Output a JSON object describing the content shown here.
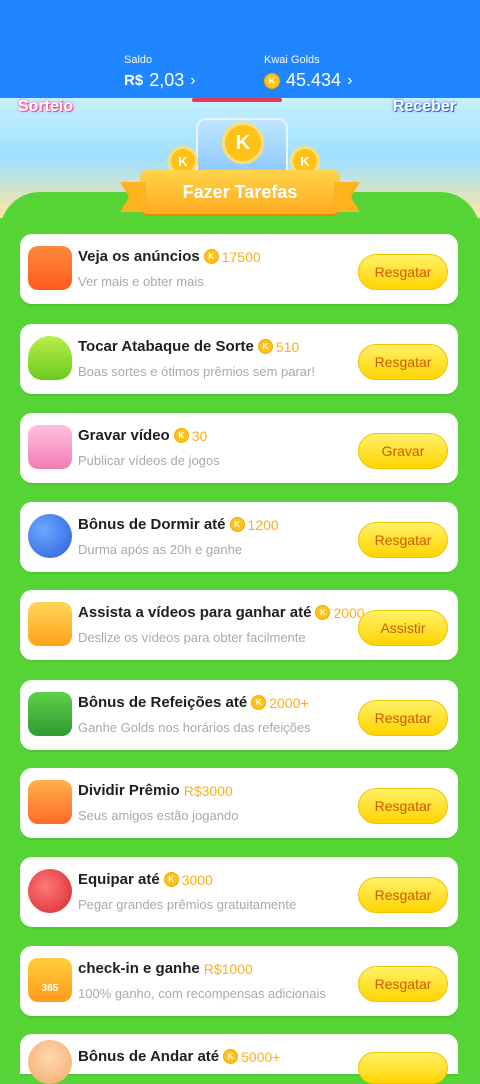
{
  "header": {
    "saldo_label": "Saldo",
    "saldo_currency": "R$",
    "saldo_value": "2,03",
    "golds_label": "Kwai Golds",
    "golds_value": "45.434"
  },
  "banner": {
    "left_text": "Sorteio",
    "right_text": "Receber",
    "section_title": "Fazer Tarefas",
    "coin_letter": "K"
  },
  "tasks": [
    {
      "title": "Veja os anúncios",
      "reward": "17500",
      "reward_type": "coin",
      "subtitle": "Ver mais e obter mais",
      "button": "Resgatar",
      "icon": "tv-icon"
    },
    {
      "title": "Tocar Atabaque de Sorte",
      "reward": "510",
      "reward_type": "coin",
      "subtitle": "Boas sortes e ótimos prêmios sem parar!",
      "button": "Resgatar",
      "icon": "drum-icon"
    },
    {
      "title": "Gravar vídeo",
      "reward": "30",
      "reward_type": "coin",
      "subtitle": "Publicar vídeos de jogos",
      "button": "Gravar",
      "icon": "camera-icon"
    },
    {
      "title": "Bônus de Dormir até",
      "reward": "1200",
      "reward_type": "coin",
      "subtitle": "Durma após as 20h e ganhe",
      "button": "Resgatar",
      "icon": "moon-icon"
    },
    {
      "title": "Assista a vídeos para ganhar até",
      "reward": "2000",
      "reward_type": "coin",
      "subtitle": "Deslize os vídeos para obter facilmente",
      "button": "Assistir",
      "icon": "video-camera-icon"
    },
    {
      "title": "Bônus de Refeições até",
      "reward": "2000+",
      "reward_type": "coin",
      "subtitle": "Ganhe Golds nos horários das refeições",
      "button": "Resgatar",
      "icon": "lunchbox-icon"
    },
    {
      "title": "Dividir Prêmio",
      "reward": "R$3000",
      "reward_type": "cash",
      "subtitle": "Seus amigos estão jogando",
      "button": "Resgatar",
      "icon": "gift-icon"
    },
    {
      "title": "Equipar até",
      "reward": "3000",
      "reward_type": "coin",
      "subtitle": "Pegar grandes prêmios gratuitamente",
      "button": "Resgatar",
      "icon": "boxing-glove-icon"
    },
    {
      "title": "check-in e ganhe",
      "reward": "R$1000",
      "reward_type": "cash",
      "subtitle": "100% ganho, com recompensas adicionais",
      "button": "Resgatar",
      "icon": "calendar-icon",
      "icon_text": "365"
    },
    {
      "title": "Bônus de Andar até",
      "reward": "5000+",
      "reward_type": "coin",
      "subtitle": "",
      "button": "",
      "icon": "walker-avatar-icon"
    }
  ],
  "colors": {
    "topbar": "#1f86ff",
    "panel": "#56d436",
    "accent_gold": "#ffad14",
    "button": "#ffd500"
  }
}
